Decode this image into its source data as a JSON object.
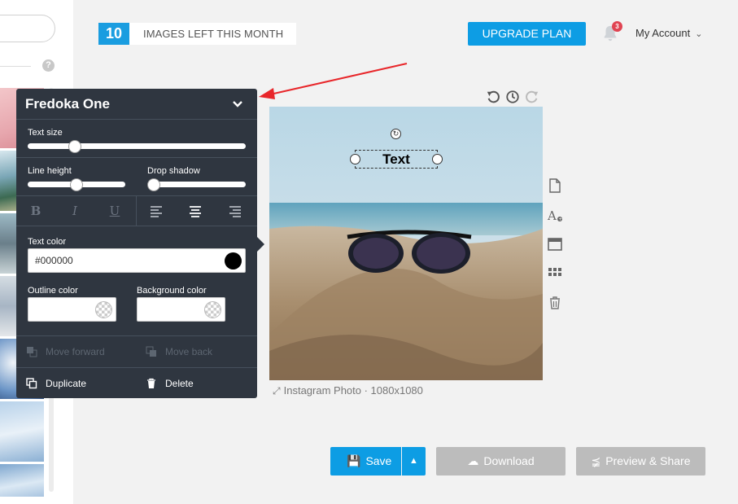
{
  "header": {
    "images_left_count": "10",
    "images_left_label": "IMAGES LEFT THIS MONTH",
    "upgrade_label": "UPGRADE PLAN",
    "notification_count": "3",
    "account_label": "My Account"
  },
  "sidebar": {
    "help_label": "?"
  },
  "canvas": {
    "text_layer": "Text",
    "caption": "Instagram Photo · 1080x1080"
  },
  "text_panel": {
    "font_name": "Fredoka One",
    "text_size_label": "Text size",
    "text_size_value": 0.2,
    "line_height_label": "Line height",
    "line_height_value": 0.5,
    "drop_shadow_label": "Drop shadow",
    "drop_shadow_value": 0.0,
    "bold_label": "B",
    "italic_label": "I",
    "underline_label": "U",
    "text_color_label": "Text color",
    "text_color_value": "#000000",
    "outline_color_label": "Outline color",
    "background_color_label": "Background color",
    "move_forward_label": "Move forward",
    "move_back_label": "Move back",
    "duplicate_label": "Duplicate",
    "delete_label": "Delete"
  },
  "actions": {
    "save_label": "Save",
    "download_label": "Download",
    "preview_share_label": "Preview & Share"
  },
  "colors": {
    "accent": "#0d9de4",
    "panel_bg": "#2f3640",
    "disabled_btn": "#bcbcbc",
    "badge": "#e04452",
    "annotation_arrow": "#e8262a"
  },
  "icons": {
    "history": [
      "undo-icon",
      "history-clock-icon",
      "redo-icon"
    ],
    "tools": [
      "page-icon",
      "add-text-icon",
      "frame-icon",
      "grid-icon",
      "trash-icon"
    ]
  }
}
